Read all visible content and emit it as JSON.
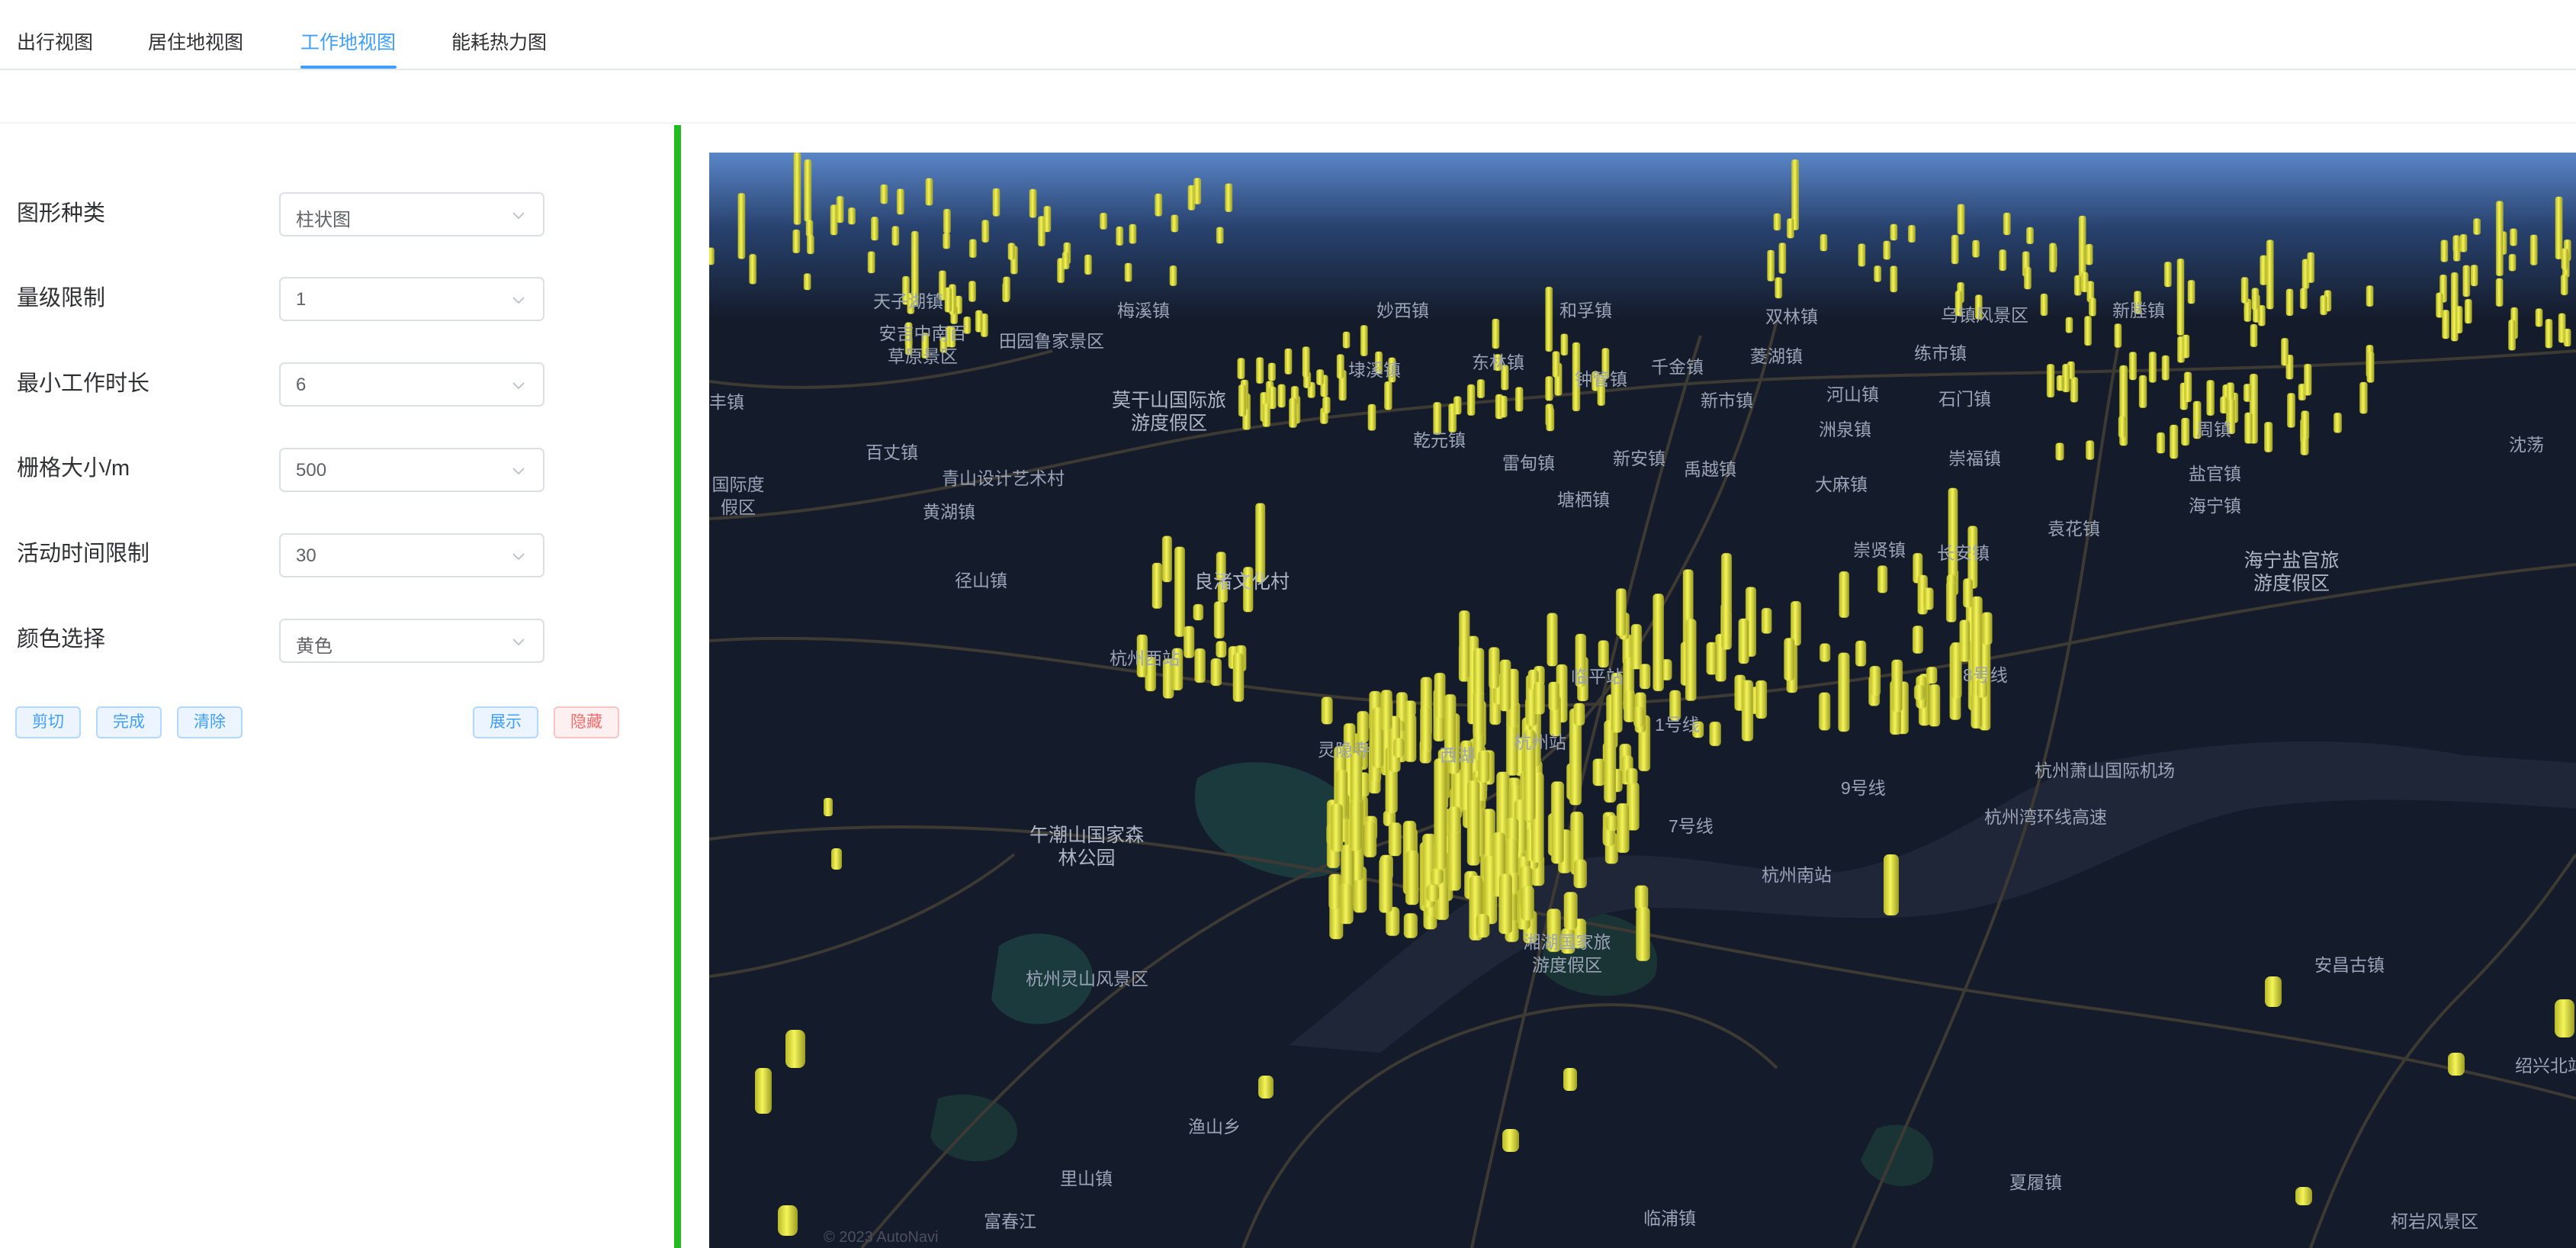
{
  "tabs": [
    {
      "label": "出行视图",
      "active": false
    },
    {
      "label": "居住地视图",
      "active": false
    },
    {
      "label": "工作地视图",
      "active": true
    },
    {
      "label": "能耗热力图",
      "active": false
    }
  ],
  "form": {
    "fields": [
      {
        "label": "图形种类",
        "value": "柱状图"
      },
      {
        "label": "量级限制",
        "value": "1"
      },
      {
        "label": "最小工作时长",
        "value": "6"
      },
      {
        "label": "栅格大小/m",
        "value": "500"
      },
      {
        "label": "活动时间限制",
        "value": "30"
      },
      {
        "label": "颜色选择",
        "value": "黄色"
      }
    ],
    "buttons": {
      "cut": "剪切",
      "done": "完成",
      "clear": "清除",
      "show": "展示",
      "hide": "隐藏"
    }
  },
  "map": {
    "bar_color": "#e8e83a",
    "labels": [
      "天子湖镇",
      "梅溪镇",
      "妙西镇",
      "和孚镇",
      "双林镇",
      "乌镇风景区",
      "新塍镇",
      "安吉中南百草原景区",
      "田园鲁家景区",
      "东林镇",
      "钟管镇",
      "千金镇",
      "菱湖镇",
      "练市镇",
      "莫干山国际旅游度假区",
      "埭溪镇",
      "乾元镇",
      "新市镇",
      "河山镇",
      "石门镇",
      "海宁盐官旅游度假区",
      "百丈镇",
      "青山设计艺术村",
      "雷甸镇",
      "新安镇",
      "禹越镇",
      "大麻镇",
      "崇福镇",
      "海宁镇",
      "袁花镇",
      "黄湖镇",
      "塘栖镇",
      "崇贤镇",
      "盐官镇",
      "径山镇",
      "良渚文化村",
      "长安镇",
      "杭州西站",
      "临平站",
      "灵隐寺",
      "西湖",
      "杭州站",
      "杭州萧山国际机场",
      "午潮山国家森林公园",
      "杭州南站",
      "湘湖国家旅游度假区",
      "杭州灵山风景区",
      "安昌古镇",
      "渔山乡",
      "里山镇",
      "临浦镇",
      "夏履镇",
      "柯岩风景区",
      "绍兴北站",
      "1号线",
      "9号线",
      "7号线",
      "8号线",
      "杭州湾环线高速",
      "富春江",
      "国际度假区",
      "丰镇",
      "周镇",
      "沈荡",
      "洲泉镇"
    ],
    "copyright": "© 2023 AutoNavi"
  }
}
